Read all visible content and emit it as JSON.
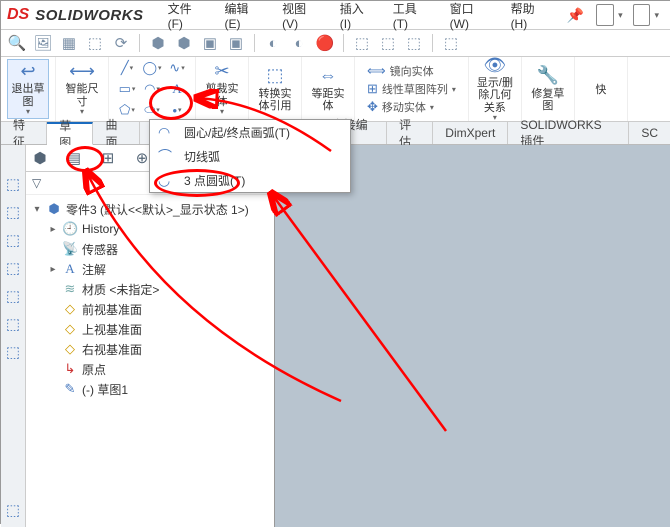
{
  "brand": {
    "logo": "DS",
    "name": "SOLIDWORKS"
  },
  "menu": {
    "file": "文件(F)",
    "edit": "编辑(E)",
    "view": "视图(V)",
    "insert": "插入(I)",
    "tools": "工具(T)",
    "window": "窗口(W)",
    "help": "帮助(H)"
  },
  "ribbon": {
    "exit_sketch": "退出草图",
    "smart_dim": "智能尺寸",
    "trim": "剪裁实体",
    "convert": "转换实体引用",
    "offset": "等距实体",
    "mirror": "镜向实体",
    "linear_pattern": "线性草图阵列",
    "move": "移动实体",
    "display_delete": "显示/删除几何关系",
    "repair": "修复草图",
    "fast": "快"
  },
  "tabs": {
    "feature": "特征",
    "sketch": "草图",
    "surface": "曲面",
    "direct_edit": "直接编辑",
    "evaluate": "评估",
    "dimxpert": "DimXpert",
    "sw_addins": "SOLIDWORKS 插件",
    "extra": "SC"
  },
  "arc_menu": {
    "centerpoint": "圆心/起/终点画弧(T)",
    "tangent": "切线弧",
    "threepoint": "3 点圆弧(T)"
  },
  "tree": {
    "root": "零件3 (默认<<默认>_显示状态 1>)",
    "history": "History",
    "sensors": "传感器",
    "annotations": "注解",
    "material": "材质 <未指定>",
    "front": "前视基准面",
    "top": "上视基准面",
    "right": "右视基准面",
    "origin": "原点",
    "sketch1": "(-) 草图1"
  },
  "icons": {
    "exit": "↩",
    "dim": "⟷",
    "line": "╱",
    "rect": "▭",
    "circle": "◯",
    "arc": "◠",
    "spline": "∿",
    "slot": "⬭",
    "poly": "⬠",
    "ellipse": "⬥",
    "text": "A",
    "point": "•",
    "trim": "✂",
    "convert": "⬚",
    "offset": "⇔",
    "mirror": "⟺",
    "pattern": "⊞",
    "move": "✥",
    "display": "👁",
    "repair": "🔧",
    "fast": "⚡",
    "filter": "▽",
    "part": "⬢",
    "history": "🕘",
    "sensor": "📡",
    "anno": "A",
    "material": "≋",
    "plane": "◇",
    "origin": "↳",
    "sketch": "✎",
    "search": "🔍",
    "doc": "📄"
  }
}
